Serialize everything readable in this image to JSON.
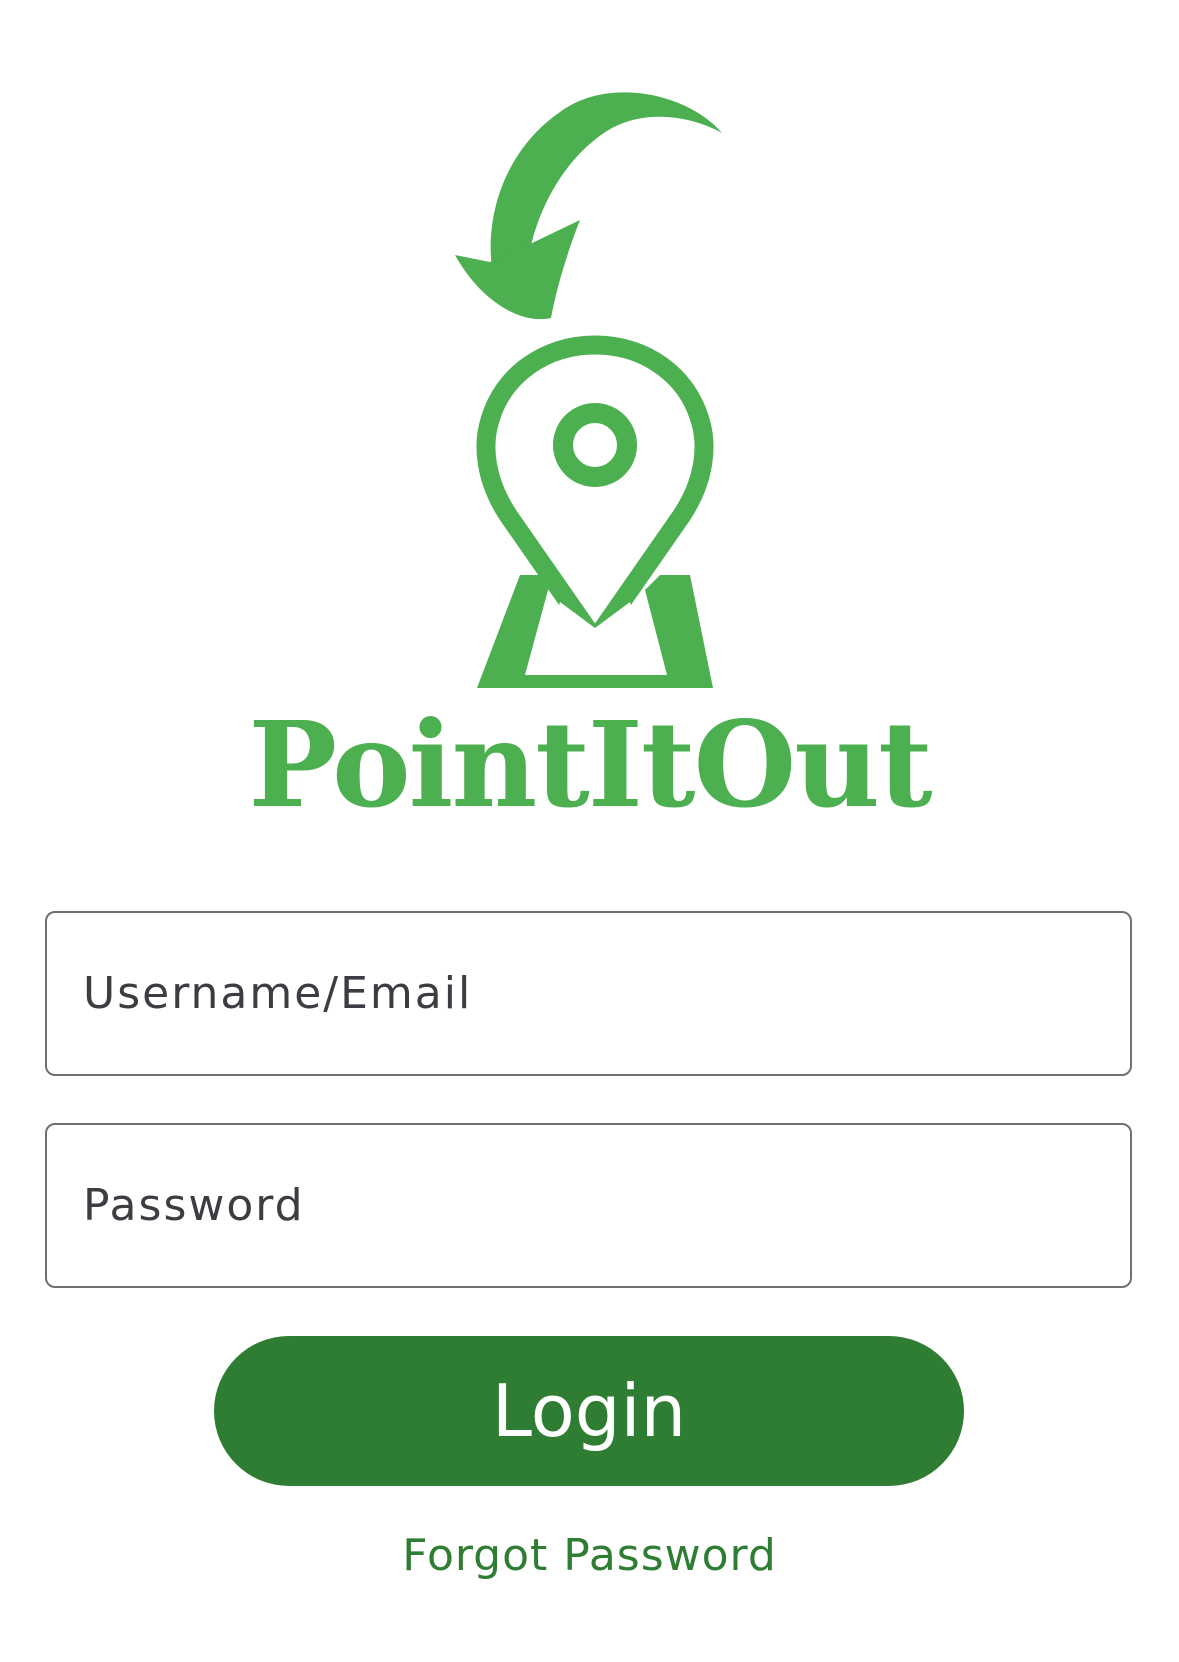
{
  "brand": {
    "name": "PointItOut",
    "color": "#4caf50"
  },
  "logo": {
    "icons": [
      "curved-arrow-icon",
      "map-pin-icon",
      "map-base-icon"
    ]
  },
  "form": {
    "username_placeholder": "Username/Email",
    "password_placeholder": "Password",
    "login_label": "Login",
    "forgot_password_label": "Forgot Password"
  },
  "colors": {
    "accent_dark": "#2e7d32",
    "accent_light": "#4caf50",
    "field_border": "#6f6f76",
    "placeholder_text": "#3c3c43"
  }
}
